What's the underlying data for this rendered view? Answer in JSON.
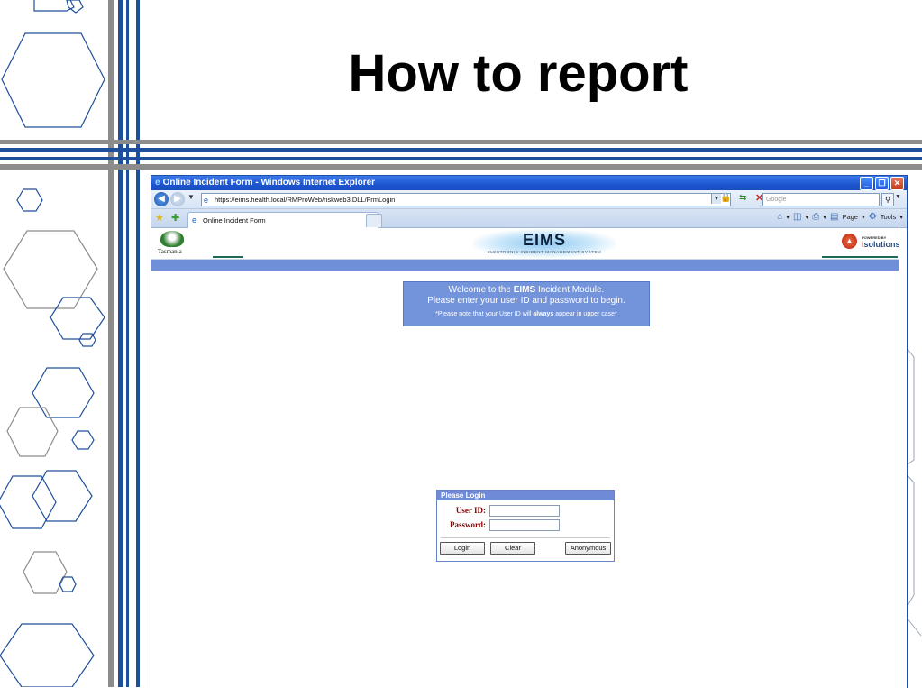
{
  "slide": {
    "title": "How to report"
  },
  "browser": {
    "window_title": "Online Incident Form - Windows Internet Explorer",
    "url": "https://eims.health.local/RMProWeb/riskweb3.DLL/FrmLogin",
    "search_placeholder": "Google",
    "tab_label": "Online Incident Form",
    "cmd_page": "Page",
    "cmd_tools": "Tools"
  },
  "app": {
    "org_label": "Tasmania",
    "logo_title": "EIMS",
    "logo_subtitle": "ELECTRONIC INCIDENT MANAGEMENT SYSTEM",
    "powered_by": "POWERED BY",
    "vendor": "solutions",
    "vendor_prefix": "i"
  },
  "welcome": {
    "line1_pre": "Welcome to the ",
    "line1_bold": "EIMS",
    "line1_post": " Incident Module.",
    "line2": "Please enter your user ID and password to begin.",
    "note_pre": "*Please note that your User ID will ",
    "note_bold": "always",
    "note_post": " appear in upper case*"
  },
  "login": {
    "header": "Please Login",
    "user_label": "User ID:",
    "password_label": "Password:",
    "login_button": "Login",
    "clear_button": "Clear",
    "anonymous_button": "Anonymous"
  },
  "colors": {
    "slide_blue": "#1d4f9c",
    "slide_grey": "#8c8c8c",
    "ie_title": "#1d55d0",
    "welcome_bg": "#7393db",
    "login_label": "#880000"
  }
}
